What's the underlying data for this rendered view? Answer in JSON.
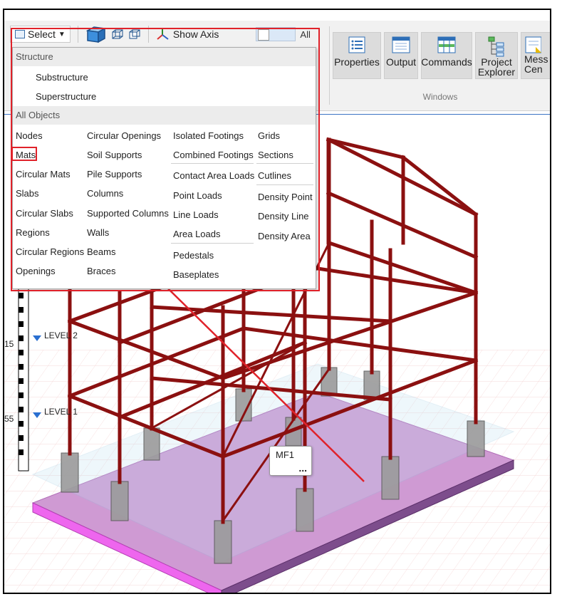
{
  "toolbar": {
    "select_label": "Select",
    "show_axis_label": "Show Axis",
    "all_label": "All"
  },
  "windows_group": {
    "title": "Windows",
    "buttons": [
      {
        "label": "Properties",
        "icon": "list-icon"
      },
      {
        "label": "Output",
        "icon": "grid-icon"
      },
      {
        "label": "Commands",
        "icon": "table-icon"
      },
      {
        "label": "Project\nExplorer",
        "icon": "tree-icon"
      },
      {
        "label": "Mess\nCen",
        "icon": "message-icon"
      }
    ]
  },
  "dropdown": {
    "structure_header": "Structure",
    "substructure": "Substructure",
    "superstructure": "Superstructure",
    "all_objects_header": "All Objects",
    "col1": [
      "Nodes",
      "Mats",
      "Circular Mats",
      "Slabs",
      "Circular Slabs",
      "Regions",
      "Circular Regions",
      "Openings"
    ],
    "col2": [
      "Circular Openings",
      "Soil Supports",
      "Pile Supports",
      "Columns",
      "Supported Columns",
      "Walls",
      "Beams",
      "Braces"
    ],
    "col3": [
      "Isolated Footings",
      "Combined Footings",
      "Contact Area Loads",
      "Point Loads",
      "Line Loads",
      "Area Loads",
      "Pedestals",
      "Baseplates"
    ],
    "col4": [
      "Grids",
      "Sections",
      "Cutlines",
      "Density Point",
      "Density Line",
      "Density Area"
    ]
  },
  "viewport": {
    "level_labels": [
      "LEVEL 2",
      "LEVEL 1"
    ],
    "scale_labels": [
      "15",
      "55"
    ],
    "tooltip_label": "MF1",
    "tooltip_more": "..."
  },
  "colors": {
    "frame_red": "#8b1010",
    "mat_pink": "#d9a6d9",
    "highlight": "#e0222a",
    "ribbon_bg": "#f1f1f1"
  }
}
